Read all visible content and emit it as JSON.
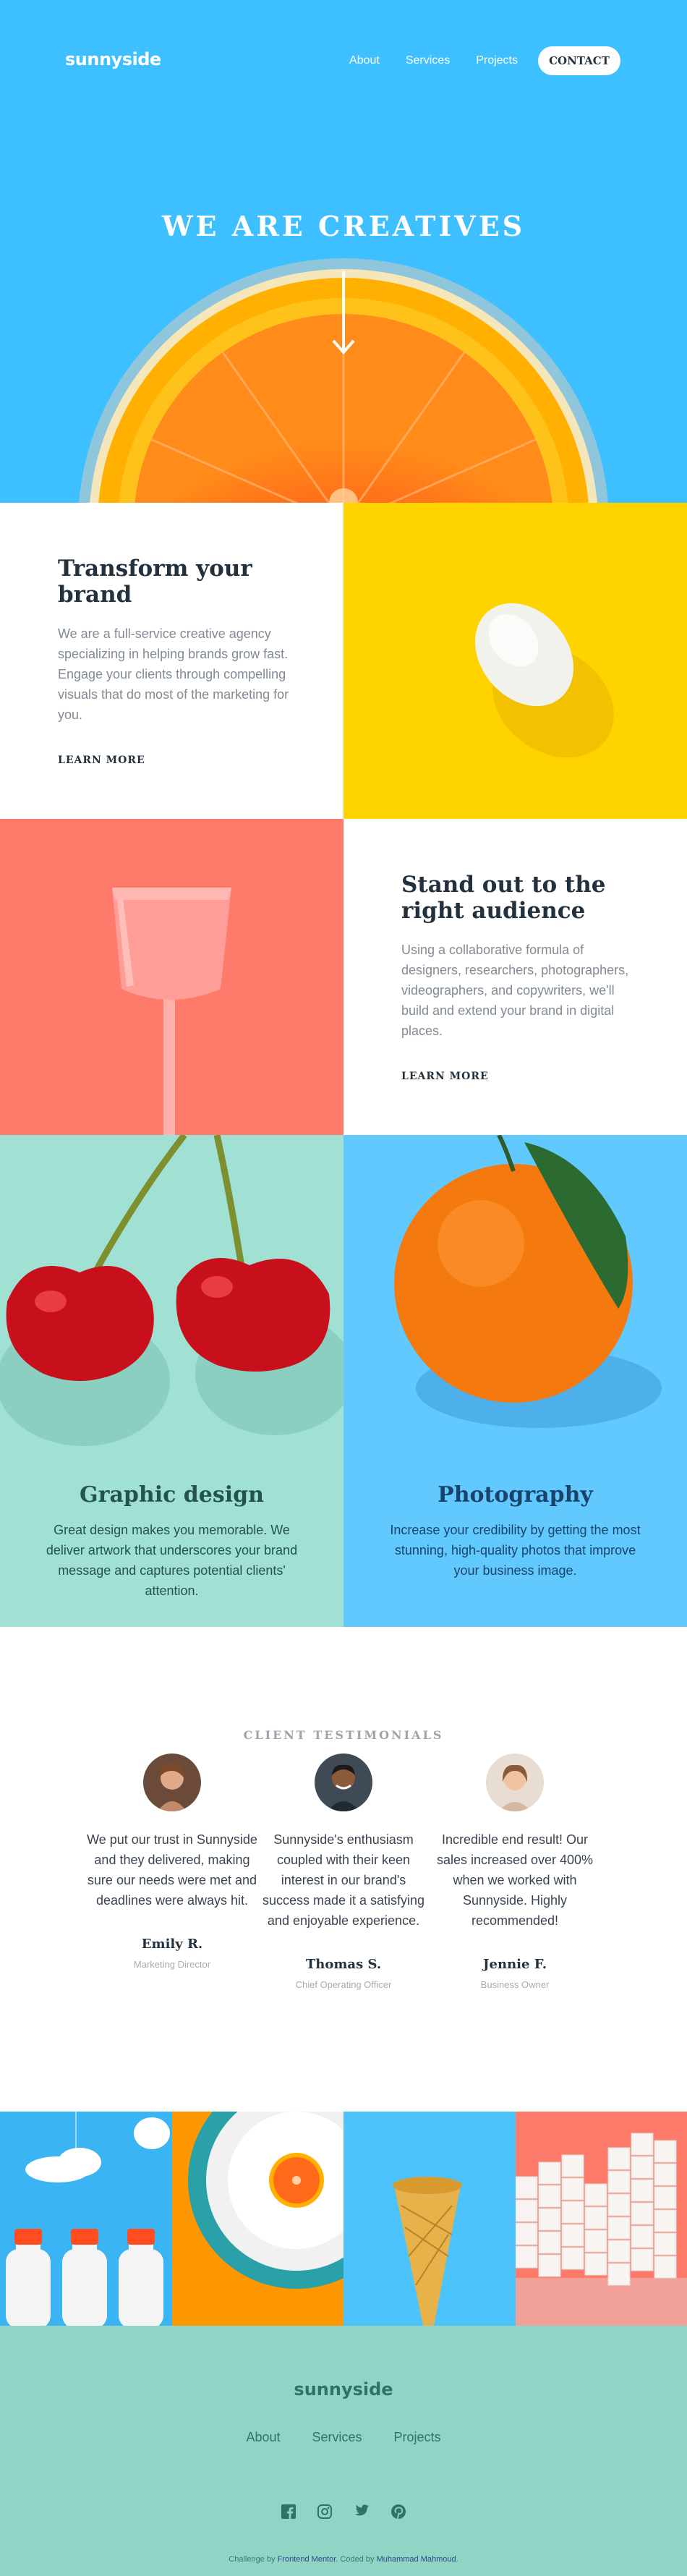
{
  "header": {
    "logo": "sunnyside",
    "nav": [
      "About",
      "Services",
      "Projects"
    ],
    "contact_label": "CONTACT"
  },
  "hero": {
    "title": "WE ARE CREATIVES"
  },
  "features": [
    {
      "title": "Transform your brand",
      "text": "We are a full-service creative agency specializing in helping brands grow fast. Engage your clients through compelling visuals that do most of the marketing for you.",
      "link": "LEARN MORE",
      "accent": "#fad400"
    },
    {
      "title": "Stand out to the right audience",
      "text": "Using a collaborative formula of designers, researchers, photographers, videographers, and copywriters, we'll build and extend your brand in digital places.",
      "link": "LEARN MORE",
      "accent": "#fe7a6a"
    }
  ],
  "services": [
    {
      "title": "Graphic design",
      "text": "Great design makes you memorable. We deliver artwork that underscores your brand message and captures potential clients' attention.",
      "bg": "#a0e1d3",
      "color": "#24534b"
    },
    {
      "title": "Photography",
      "text": "Increase your credibility by getting the most stunning, high-quality photos that improve your business image.",
      "bg": "#62c9ff",
      "color": "#19436b"
    }
  ],
  "testimonials": {
    "heading": "CLIENT TESTIMONIALS",
    "items": [
      {
        "quote": "We put our trust in Sunnyside and they delivered, making sure our needs were met and deadlines were always hit.",
        "name": "Emily R.",
        "role": "Marketing Director"
      },
      {
        "quote": "Sunnyside's enthusiasm coupled with their keen interest in our brand's success made it a satisfying and enjoyable experience.",
        "name": "Thomas S.",
        "role": "Chief Operating Officer"
      },
      {
        "quote": "Incredible end result! Our sales increased over 400% when we worked with Sunnyside. Highly recommended!",
        "name": "Jennie F.",
        "role": "Business Owner"
      }
    ]
  },
  "gallery": [
    "milk-bottles",
    "orange-on-plate",
    "ice-cream-cone",
    "sugar-cubes"
  ],
  "footer": {
    "logo": "sunnyside",
    "nav": [
      "About",
      "Services",
      "Projects"
    ],
    "social": [
      "facebook-icon",
      "instagram-icon",
      "twitter-icon",
      "pinterest-icon"
    ],
    "credit_prefix": "Challenge by ",
    "credit_link1": "Frontend Mentor",
    "credit_mid": ". Coded by ",
    "credit_link2": "Muhammad Mahmoud",
    "credit_suffix": "."
  },
  "colors": {
    "hero_bg": "#3ebfff",
    "yellow": "#fed300",
    "coral": "#fe7a6a",
    "footer_bg": "#90d4c5"
  }
}
